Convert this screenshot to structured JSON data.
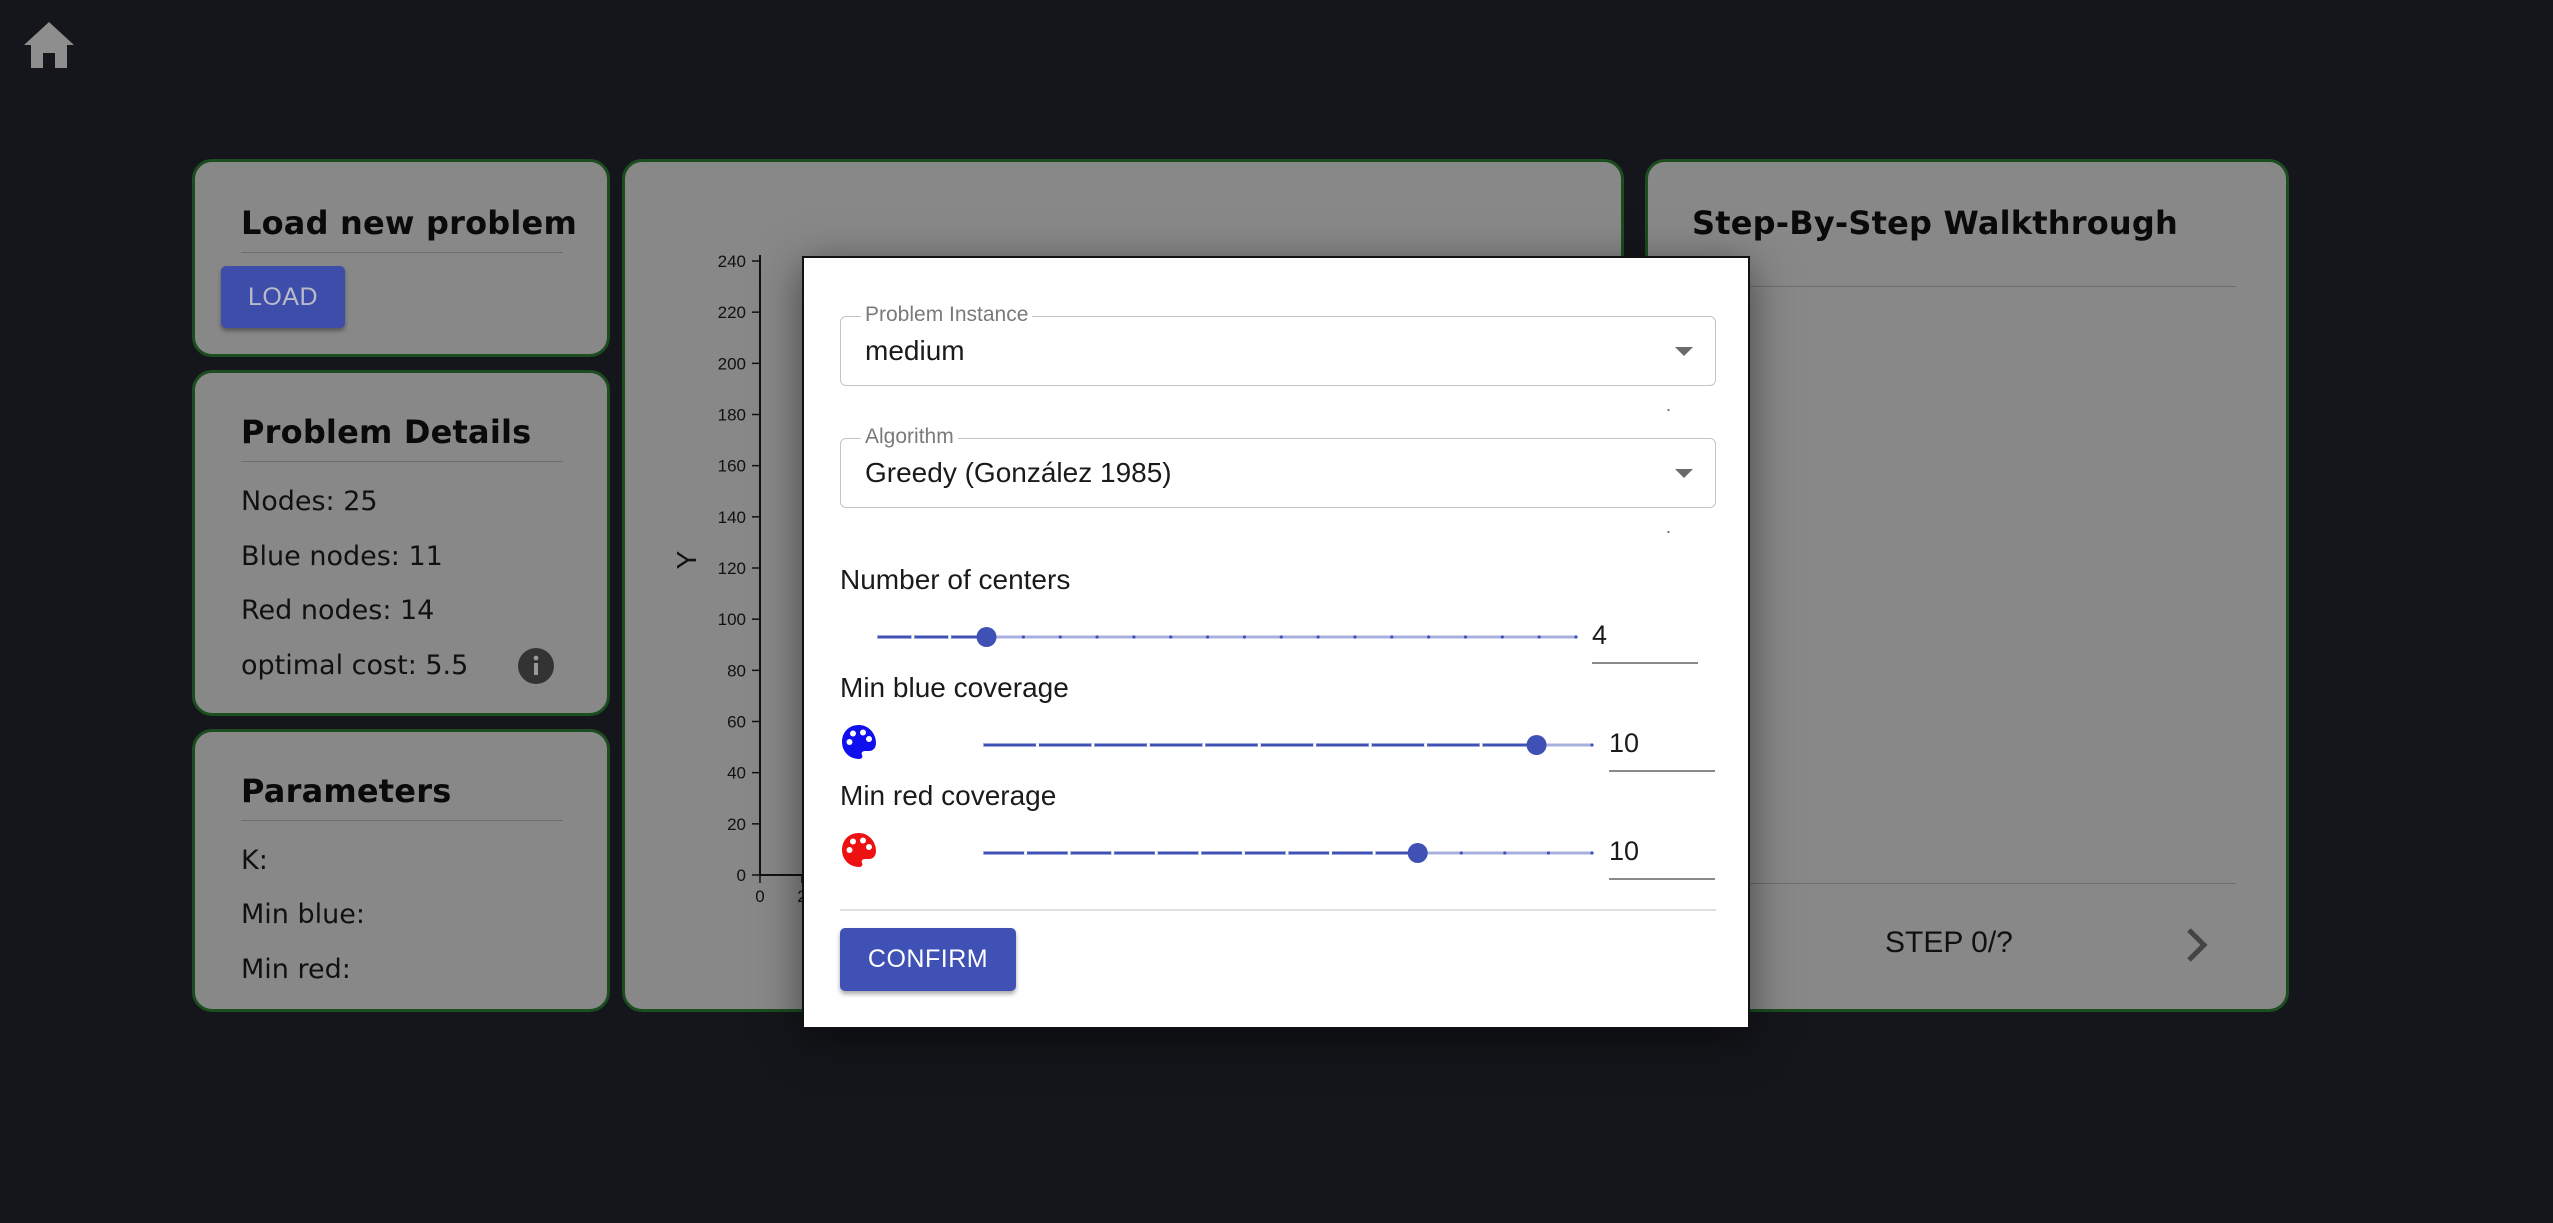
{
  "colors": {
    "background": "#15161b",
    "panel": "#888888",
    "panel_border": "#1b4d1f",
    "primary": "#3f51b5",
    "blue_palette": "#1010ee",
    "red_palette": "#ee1111"
  },
  "home": {
    "icon": "home-icon"
  },
  "load_panel": {
    "title": "Load new problem",
    "load_label": "LOAD"
  },
  "details_panel": {
    "title": "Problem Details",
    "nodes": "Nodes: 25",
    "blue_nodes": "Blue nodes: 11",
    "red_nodes": "Red nodes: 14",
    "optimal_cost": "optimal cost: 5.5",
    "info_icon": "info-icon"
  },
  "parameters_panel": {
    "title": "Parameters",
    "k_label": "K:",
    "min_blue_label": "Min blue:",
    "min_red_label": "Min red:"
  },
  "chart_data": {
    "type": "scatter",
    "ylabel": "Y",
    "yticks": [
      "0",
      "20",
      "40",
      "60",
      "80",
      "100",
      "120",
      "140",
      "160",
      "180",
      "200",
      "220",
      "240"
    ],
    "xticks_visible": [
      "0",
      "2"
    ],
    "ylim": [
      0,
      240
    ]
  },
  "walkthrough_panel": {
    "title": "Step-By-Step Walkthrough",
    "step_label": "STEP 0/?",
    "next_icon": "chevron-right-icon"
  },
  "dialog": {
    "problem_instance": {
      "label": "Problem Instance",
      "value": "medium",
      "helper": "."
    },
    "algorithm": {
      "label": "Algorithm",
      "value": "Greedy (González 1985)",
      "helper": "."
    },
    "centers": {
      "label": "Number of centers",
      "value": "4",
      "min": 1,
      "max": 20,
      "current": 4
    },
    "min_blue": {
      "label": "Min blue coverage",
      "value": "10",
      "min": 0,
      "max": 11,
      "current": 10,
      "icon": "palette-icon"
    },
    "min_red": {
      "label": "Min red coverage",
      "value": "10",
      "min": 0,
      "max": 14,
      "current": 10,
      "icon": "palette-icon"
    },
    "confirm_label": "CONFIRM"
  }
}
